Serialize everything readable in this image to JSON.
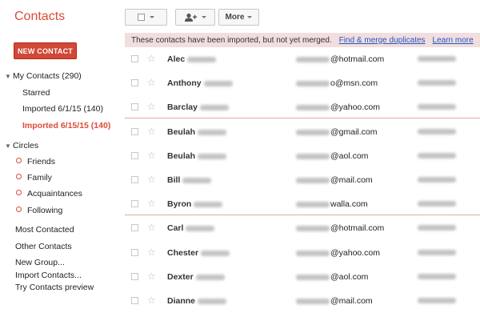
{
  "app": {
    "title": "Contacts"
  },
  "sidebar": {
    "new_contact_label": "NEW CONTACT",
    "my_contacts": "My Contacts (290)",
    "groups": [
      {
        "label": "Starred"
      },
      {
        "label": "Imported 6/1/15 (140)"
      },
      {
        "label": "Imported 6/15/15 (140)",
        "active": true
      }
    ],
    "circles_label": "Circles",
    "circles": [
      {
        "label": "Friends"
      },
      {
        "label": "Family"
      },
      {
        "label": "Acquaintances"
      },
      {
        "label": "Following"
      }
    ],
    "most_contacted": "Most Contacted",
    "other_contacts": "Other Contacts",
    "links": [
      "New Group...",
      "Import Contacts...",
      "Try Contacts preview"
    ]
  },
  "toolbar": {
    "more_label": "More"
  },
  "banner": {
    "message": "These contacts have been imported, but not yet merged.",
    "find_merge": "Find & merge duplicates",
    "learn_more": "Learn more"
  },
  "contacts": [
    {
      "first": "Alec",
      "email_domain": "@hotmail.com"
    },
    {
      "first": "Anthony",
      "email_domain": "o@msn.com"
    },
    {
      "first": "Barclay",
      "email_domain": "@yahoo.com"
    },
    {
      "first": "Beulah",
      "email_domain": "@gmail.com"
    },
    {
      "first": "Beulah",
      "email_domain": "@aol.com"
    },
    {
      "first": "Bill",
      "email_domain": "@mail.com"
    },
    {
      "first": "Byron",
      "email_domain": "walla.com"
    },
    {
      "first": "Carl",
      "email_domain": "@hotmail.com"
    },
    {
      "first": "Chester",
      "email_domain": "@yahoo.com"
    },
    {
      "first": "Dexter",
      "email_domain": "@aol.com"
    },
    {
      "first": "Dianne",
      "email_domain": "@mail.com"
    }
  ],
  "colors": {
    "accent": "#dd4b39",
    "banner_bg": "#f2dede",
    "link": "#2256c5"
  }
}
